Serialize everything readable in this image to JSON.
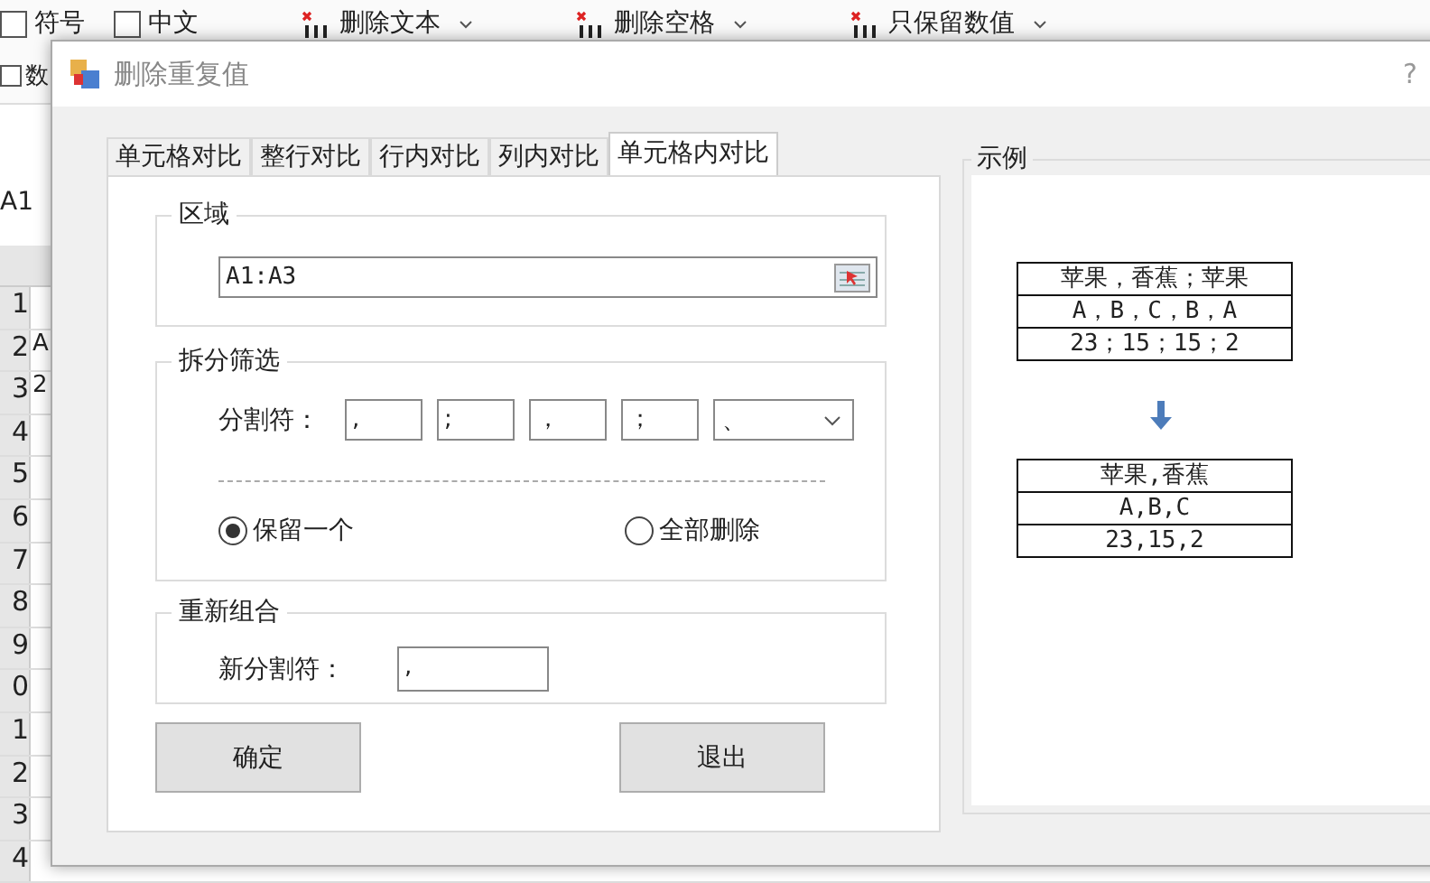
{
  "background": {
    "ribbon": [
      {
        "kind": "checkbox",
        "label": "符号",
        "checked": false
      },
      {
        "kind": "checkbox",
        "label": "中文",
        "checked": false
      },
      {
        "kind": "button",
        "label": "删除文本"
      },
      {
        "kind": "button",
        "label": "删除空格"
      },
      {
        "kind": "button",
        "label": "只保留数值"
      }
    ],
    "ribbon_row2": [
      {
        "kind": "checkbox",
        "label": "数",
        "checked": false
      }
    ],
    "name_box": "A1",
    "rows": [
      {
        "header": "1",
        "cell": ""
      },
      {
        "header": "2",
        "cell": "A"
      },
      {
        "header": "3",
        "cell": "2"
      },
      {
        "header": "4",
        "cell": ""
      },
      {
        "header": "5",
        "cell": ""
      },
      {
        "header": "6",
        "cell": ""
      },
      {
        "header": "7",
        "cell": ""
      },
      {
        "header": "8",
        "cell": ""
      },
      {
        "header": "9",
        "cell": ""
      },
      {
        "header": "0",
        "cell": ""
      },
      {
        "header": "1",
        "cell": ""
      },
      {
        "header": "2",
        "cell": ""
      },
      {
        "header": "3",
        "cell": ""
      },
      {
        "header": "4",
        "cell": ""
      }
    ]
  },
  "dialog": {
    "title": "删除重复值",
    "help": "?",
    "tabs": [
      {
        "label": "单元格对比",
        "selected": false
      },
      {
        "label": "整行对比",
        "selected": false
      },
      {
        "label": "行内对比",
        "selected": false
      },
      {
        "label": "列内对比",
        "selected": false
      },
      {
        "label": "单元格内对比",
        "selected": true
      }
    ],
    "region": {
      "label": "区域",
      "value": "A1:A3"
    },
    "split": {
      "label": "拆分筛选",
      "separator_label": "分割符：",
      "separators": [
        ",",
        ";",
        "，",
        "；"
      ],
      "dropdown": "、",
      "options": [
        {
          "label": "保留一个",
          "selected": true
        },
        {
          "label": "全部删除",
          "selected": false
        }
      ]
    },
    "recombine": {
      "label": "重新组合",
      "separator_label": "新分割符：",
      "value": ","
    },
    "buttons": [
      "确定",
      "退出"
    ],
    "example": {
      "label": "示例",
      "before": [
        "苹果，香蕉；苹果",
        "A，B，C，B，A",
        "23；15；15；2"
      ],
      "after": [
        "苹果,香蕉",
        "A,B,C",
        "23,15,2"
      ]
    }
  }
}
